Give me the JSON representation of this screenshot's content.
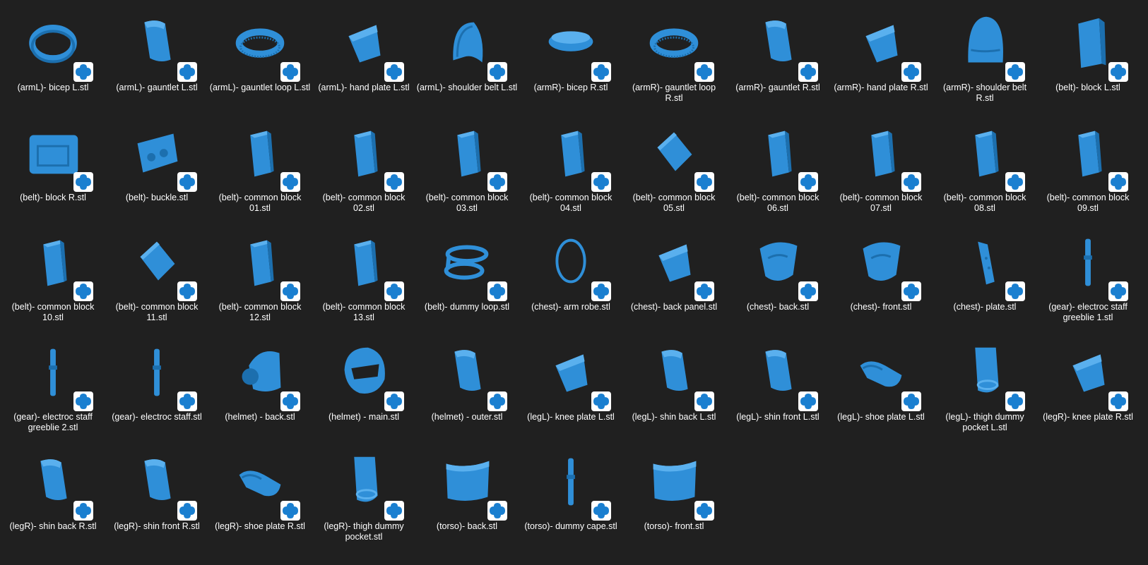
{
  "colors": {
    "background": "#202020",
    "model_blue": "#2f8fd8",
    "model_blue_dark": "#1c6fae",
    "model_blue_light": "#5ab0ee",
    "badge_bg": "#ffffff",
    "badge_icon": "#1a7fd0",
    "label_text": "#ffffff"
  },
  "badge_icon": "3d-viewer-app-icon",
  "files": [
    {
      "name": "(armL)- bicep L.stl",
      "shape": "ring"
    },
    {
      "name": "(armL)- gauntlet L.stl",
      "shape": "curved-plate"
    },
    {
      "name": "(armL)- gauntlet loop L.stl",
      "shape": "ring-ribbed"
    },
    {
      "name": "(armL)- hand plate L.stl",
      "shape": "flat-plate"
    },
    {
      "name": "(armL)- shoulder belt L.stl",
      "shape": "shell"
    },
    {
      "name": "(armR)- bicep R.stl",
      "shape": "band"
    },
    {
      "name": "(armR)- gauntlet loop R.stl",
      "shape": "ring-ribbed"
    },
    {
      "name": "(armR)- gauntlet R.stl",
      "shape": "curved-plate"
    },
    {
      "name": "(armR)- hand plate R.stl",
      "shape": "flat-plate"
    },
    {
      "name": "(armR)- shoulder belt R.stl",
      "shape": "dome"
    },
    {
      "name": "(belt)- block L.stl",
      "shape": "tall-block"
    },
    {
      "name": "(belt)- block R.stl",
      "shape": "wide-block"
    },
    {
      "name": "(belt)- buckle.stl",
      "shape": "buckle"
    },
    {
      "name": "(belt)- common block 01.stl",
      "shape": "block"
    },
    {
      "name": "(belt)- common block 02.stl",
      "shape": "block"
    },
    {
      "name": "(belt)- common block 03.stl",
      "shape": "block"
    },
    {
      "name": "(belt)- common block 04.stl",
      "shape": "block"
    },
    {
      "name": "(belt)- common block 05.stl",
      "shape": "tilted-block"
    },
    {
      "name": "(belt)- common block 06.stl",
      "shape": "block"
    },
    {
      "name": "(belt)- common block 07.stl",
      "shape": "block"
    },
    {
      "name": "(belt)- common block 08.stl",
      "shape": "block"
    },
    {
      "name": "(belt)- common block 09.stl",
      "shape": "block"
    },
    {
      "name": "(belt)- common block 10.stl",
      "shape": "block"
    },
    {
      "name": "(belt)- common block 11.stl",
      "shape": "tilted-block"
    },
    {
      "name": "(belt)- common block 12.stl",
      "shape": "block"
    },
    {
      "name": "(belt)- common block 13.stl",
      "shape": "block"
    },
    {
      "name": "(belt)- dummy loop.stl",
      "shape": "loop"
    },
    {
      "name": "(chest)- arm robe.stl",
      "shape": "thin-ring"
    },
    {
      "name": "(chest)- back panel.stl",
      "shape": "flat-plate"
    },
    {
      "name": "(chest)- back.stl",
      "shape": "armor"
    },
    {
      "name": "(chest)- front.stl",
      "shape": "armor"
    },
    {
      "name": "(chest)- plate.stl",
      "shape": "slim-plate"
    },
    {
      "name": "(gear)- electroc staff greeblie 1.stl",
      "shape": "rod"
    },
    {
      "name": "(gear)- electroc staff greeblie 2.stl",
      "shape": "rod"
    },
    {
      "name": "(gear)- electroc staff.stl",
      "shape": "rod"
    },
    {
      "name": "(helmet) - back.stl",
      "shape": "helmet-back"
    },
    {
      "name": "(helmet) - main.stl",
      "shape": "helmet"
    },
    {
      "name": "(helmet) - outer.stl",
      "shape": "curved-plate"
    },
    {
      "name": "(legL)- knee plate L.stl",
      "shape": "flat-plate"
    },
    {
      "name": "(legL)- shin back L.stl",
      "shape": "curved-plate"
    },
    {
      "name": "(legL)- shin front L.stl",
      "shape": "curved-plate"
    },
    {
      "name": "(legL)- shoe plate L.stl",
      "shape": "shoe"
    },
    {
      "name": "(legL)- thigh dummy pocket L.stl",
      "shape": "pocket"
    },
    {
      "name": "(legR)- knee plate R.stl",
      "shape": "flat-plate"
    },
    {
      "name": "(legR)- shin back R.stl",
      "shape": "curved-plate"
    },
    {
      "name": "(legR)- shin front R.stl",
      "shape": "curved-plate"
    },
    {
      "name": "(legR)- shoe plate R.stl",
      "shape": "shoe"
    },
    {
      "name": "(legR)- thigh dummy pocket.stl",
      "shape": "pocket"
    },
    {
      "name": "(torso)- back.stl",
      "shape": "curved-wide"
    },
    {
      "name": "(torso)- dummy cape.stl",
      "shape": "rod"
    },
    {
      "name": "(torso)- front.stl",
      "shape": "curved-wide"
    }
  ]
}
